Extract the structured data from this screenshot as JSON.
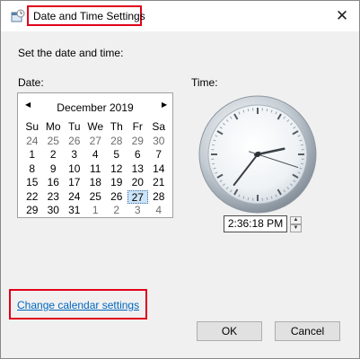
{
  "window": {
    "title": "Date and Time Settings",
    "close_glyph": "✕"
  },
  "instruction": "Set the date and time:",
  "labels": {
    "date": "Date:",
    "time": "Time:"
  },
  "calendar": {
    "prev_glyph": "◀",
    "next_glyph": "▶",
    "month": "December 2019",
    "weekdays": [
      "Su",
      "Mo",
      "Tu",
      "We",
      "Th",
      "Fr",
      "Sa"
    ],
    "weeks": [
      [
        "24",
        "25",
        "26",
        "27",
        "28",
        "29",
        "30"
      ],
      [
        "1",
        "2",
        "3",
        "4",
        "5",
        "6",
        "7"
      ],
      [
        "8",
        "9",
        "10",
        "11",
        "12",
        "13",
        "14"
      ],
      [
        "15",
        "16",
        "17",
        "18",
        "19",
        "20",
        "21"
      ],
      [
        "22",
        "23",
        "24",
        "25",
        "26",
        "27",
        "28"
      ],
      [
        "29",
        "30",
        "31",
        "1",
        "2",
        "3",
        "4"
      ]
    ],
    "selected_day": "27"
  },
  "clock": {
    "hour": 2,
    "minute": 36,
    "second": 18
  },
  "time_field": {
    "value": "2:36:18 PM",
    "up_glyph": "▲",
    "down_glyph": "▼"
  },
  "link": {
    "label": "Change calendar settings"
  },
  "buttons": {
    "ok": "OK",
    "cancel": "Cancel"
  },
  "colors": {
    "highlight_border": "#e0001b",
    "link": "#0067c0",
    "dialog_bg": "#f0f0f0"
  }
}
